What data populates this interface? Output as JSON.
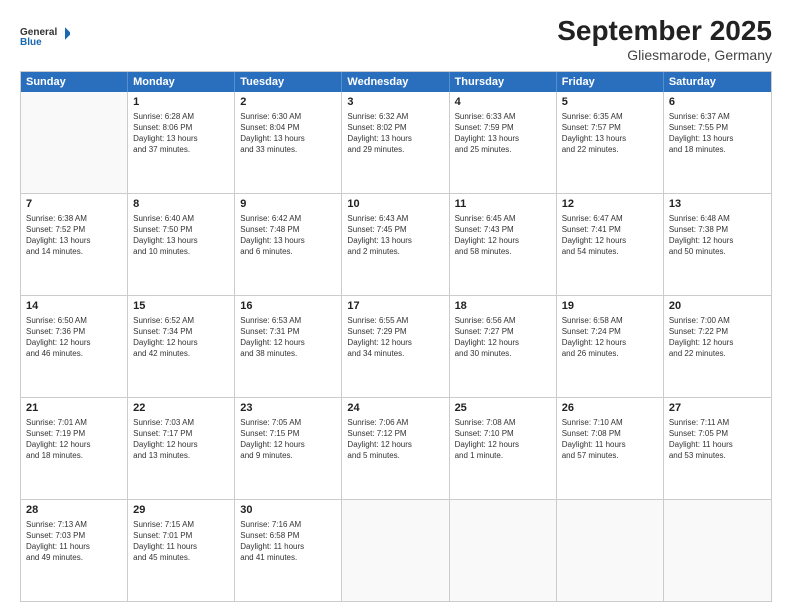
{
  "header": {
    "logo_line1": "General",
    "logo_line2": "Blue",
    "month": "September 2025",
    "location": "Gliesmarode, Germany"
  },
  "days_of_week": [
    "Sunday",
    "Monday",
    "Tuesday",
    "Wednesday",
    "Thursday",
    "Friday",
    "Saturday"
  ],
  "weeks": [
    [
      {
        "day": "",
        "text": ""
      },
      {
        "day": "1",
        "text": "Sunrise: 6:28 AM\nSunset: 8:06 PM\nDaylight: 13 hours\nand 37 minutes."
      },
      {
        "day": "2",
        "text": "Sunrise: 6:30 AM\nSunset: 8:04 PM\nDaylight: 13 hours\nand 33 minutes."
      },
      {
        "day": "3",
        "text": "Sunrise: 6:32 AM\nSunset: 8:02 PM\nDaylight: 13 hours\nand 29 minutes."
      },
      {
        "day": "4",
        "text": "Sunrise: 6:33 AM\nSunset: 7:59 PM\nDaylight: 13 hours\nand 25 minutes."
      },
      {
        "day": "5",
        "text": "Sunrise: 6:35 AM\nSunset: 7:57 PM\nDaylight: 13 hours\nand 22 minutes."
      },
      {
        "day": "6",
        "text": "Sunrise: 6:37 AM\nSunset: 7:55 PM\nDaylight: 13 hours\nand 18 minutes."
      }
    ],
    [
      {
        "day": "7",
        "text": "Sunrise: 6:38 AM\nSunset: 7:52 PM\nDaylight: 13 hours\nand 14 minutes."
      },
      {
        "day": "8",
        "text": "Sunrise: 6:40 AM\nSunset: 7:50 PM\nDaylight: 13 hours\nand 10 minutes."
      },
      {
        "day": "9",
        "text": "Sunrise: 6:42 AM\nSunset: 7:48 PM\nDaylight: 13 hours\nand 6 minutes."
      },
      {
        "day": "10",
        "text": "Sunrise: 6:43 AM\nSunset: 7:45 PM\nDaylight: 13 hours\nand 2 minutes."
      },
      {
        "day": "11",
        "text": "Sunrise: 6:45 AM\nSunset: 7:43 PM\nDaylight: 12 hours\nand 58 minutes."
      },
      {
        "day": "12",
        "text": "Sunrise: 6:47 AM\nSunset: 7:41 PM\nDaylight: 12 hours\nand 54 minutes."
      },
      {
        "day": "13",
        "text": "Sunrise: 6:48 AM\nSunset: 7:38 PM\nDaylight: 12 hours\nand 50 minutes."
      }
    ],
    [
      {
        "day": "14",
        "text": "Sunrise: 6:50 AM\nSunset: 7:36 PM\nDaylight: 12 hours\nand 46 minutes."
      },
      {
        "day": "15",
        "text": "Sunrise: 6:52 AM\nSunset: 7:34 PM\nDaylight: 12 hours\nand 42 minutes."
      },
      {
        "day": "16",
        "text": "Sunrise: 6:53 AM\nSunset: 7:31 PM\nDaylight: 12 hours\nand 38 minutes."
      },
      {
        "day": "17",
        "text": "Sunrise: 6:55 AM\nSunset: 7:29 PM\nDaylight: 12 hours\nand 34 minutes."
      },
      {
        "day": "18",
        "text": "Sunrise: 6:56 AM\nSunset: 7:27 PM\nDaylight: 12 hours\nand 30 minutes."
      },
      {
        "day": "19",
        "text": "Sunrise: 6:58 AM\nSunset: 7:24 PM\nDaylight: 12 hours\nand 26 minutes."
      },
      {
        "day": "20",
        "text": "Sunrise: 7:00 AM\nSunset: 7:22 PM\nDaylight: 12 hours\nand 22 minutes."
      }
    ],
    [
      {
        "day": "21",
        "text": "Sunrise: 7:01 AM\nSunset: 7:19 PM\nDaylight: 12 hours\nand 18 minutes."
      },
      {
        "day": "22",
        "text": "Sunrise: 7:03 AM\nSunset: 7:17 PM\nDaylight: 12 hours\nand 13 minutes."
      },
      {
        "day": "23",
        "text": "Sunrise: 7:05 AM\nSunset: 7:15 PM\nDaylight: 12 hours\nand 9 minutes."
      },
      {
        "day": "24",
        "text": "Sunrise: 7:06 AM\nSunset: 7:12 PM\nDaylight: 12 hours\nand 5 minutes."
      },
      {
        "day": "25",
        "text": "Sunrise: 7:08 AM\nSunset: 7:10 PM\nDaylight: 12 hours\nand 1 minute."
      },
      {
        "day": "26",
        "text": "Sunrise: 7:10 AM\nSunset: 7:08 PM\nDaylight: 11 hours\nand 57 minutes."
      },
      {
        "day": "27",
        "text": "Sunrise: 7:11 AM\nSunset: 7:05 PM\nDaylight: 11 hours\nand 53 minutes."
      }
    ],
    [
      {
        "day": "28",
        "text": "Sunrise: 7:13 AM\nSunset: 7:03 PM\nDaylight: 11 hours\nand 49 minutes."
      },
      {
        "day": "29",
        "text": "Sunrise: 7:15 AM\nSunset: 7:01 PM\nDaylight: 11 hours\nand 45 minutes."
      },
      {
        "day": "30",
        "text": "Sunrise: 7:16 AM\nSunset: 6:58 PM\nDaylight: 11 hours\nand 41 minutes."
      },
      {
        "day": "",
        "text": ""
      },
      {
        "day": "",
        "text": ""
      },
      {
        "day": "",
        "text": ""
      },
      {
        "day": "",
        "text": ""
      }
    ]
  ]
}
